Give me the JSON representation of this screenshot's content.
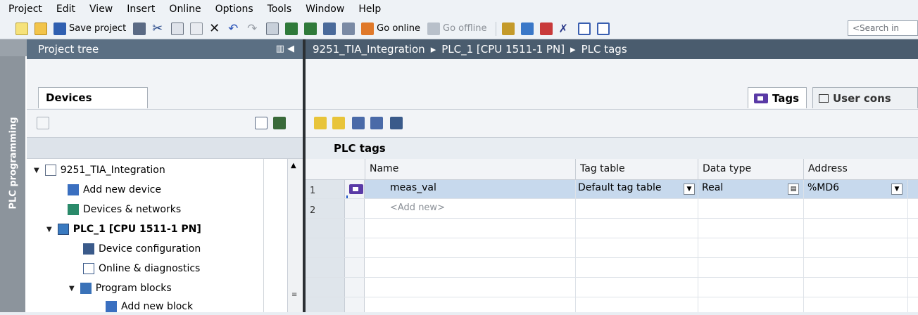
{
  "menu": [
    "Project",
    "Edit",
    "View",
    "Insert",
    "Online",
    "Options",
    "Tools",
    "Window",
    "Help"
  ],
  "toolbar": {
    "save_label": "Save project",
    "go_online_label": "Go online",
    "go_offline_label": "Go offline",
    "search_placeholder": "<Search in"
  },
  "sidebar": {
    "vertical_label": "PLC programming"
  },
  "project_tree": {
    "title": "Project tree",
    "tab_label": "Devices",
    "items": [
      {
        "label": "9251_TIA_Integration",
        "expanded": true,
        "bold": false
      },
      {
        "label": "Add new device",
        "expanded": false,
        "bold": false
      },
      {
        "label": "Devices & networks",
        "expanded": false,
        "bold": false
      },
      {
        "label": "PLC_1 [CPU 1511-1 PN]",
        "expanded": true,
        "bold": true
      },
      {
        "label": "Device configuration",
        "expanded": false,
        "bold": false
      },
      {
        "label": "Online & diagnostics",
        "expanded": false,
        "bold": false
      },
      {
        "label": "Program blocks",
        "expanded": true,
        "bold": false
      },
      {
        "label": "Add new block",
        "expanded": false,
        "bold": false
      }
    ]
  },
  "breadcrumb": {
    "parts": [
      "9251_TIA_Integration",
      "PLC_1 [CPU 1511-1 PN]",
      "PLC tags"
    ],
    "separator": "▸"
  },
  "editor_tabs": {
    "tags_label": "Tags",
    "user_constants_label": "User cons"
  },
  "table": {
    "title": "PLC tags",
    "columns": [
      "Name",
      "Tag table",
      "Data type",
      "Address"
    ],
    "rows": [
      {
        "num": "1",
        "name": "meas_val",
        "tag_table": "Default tag table",
        "data_type": "Real",
        "address": "%MD6"
      },
      {
        "num": "2",
        "name": "<Add new>",
        "tag_table": "",
        "data_type": "",
        "address": ""
      }
    ]
  },
  "colors": {
    "header_dark": "#4a5c6e",
    "tree_header": "#5b6f83",
    "selection": "#c7d9ed",
    "tag_icon": "#5a3aa6"
  }
}
